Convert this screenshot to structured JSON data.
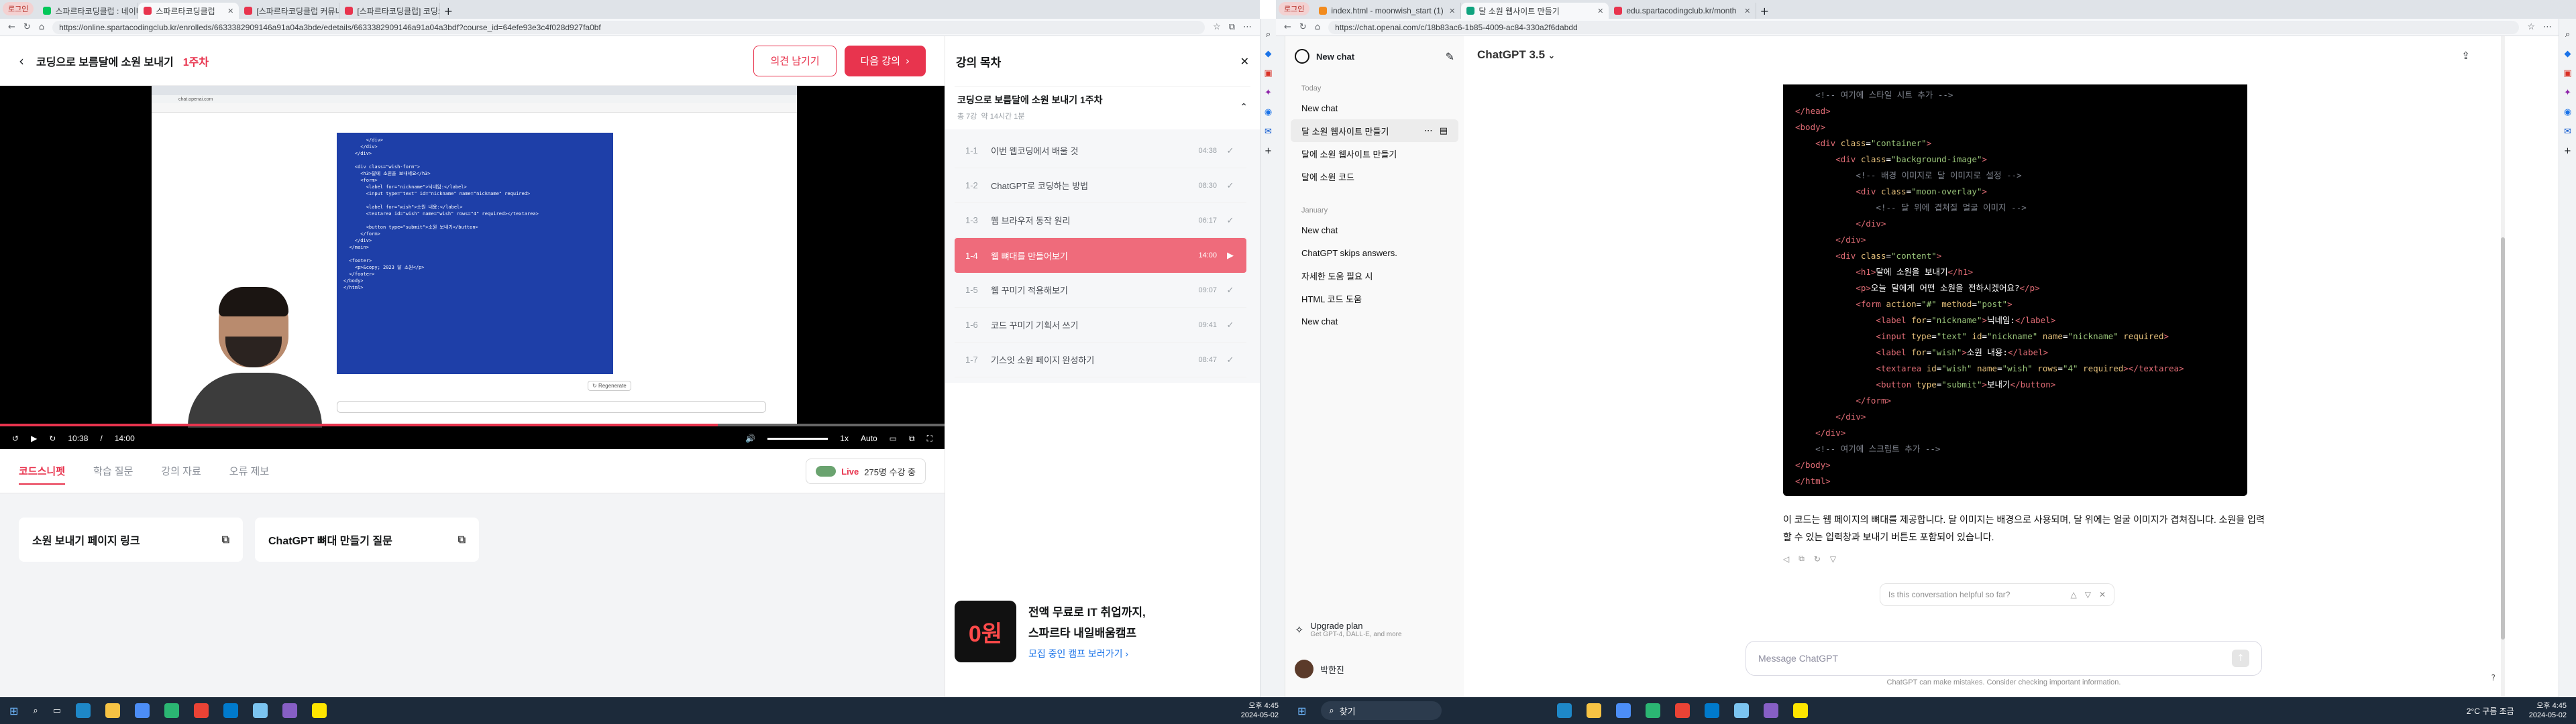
{
  "left_browser": {
    "profile": "로그인",
    "tabs": [
      {
        "label": "스파르타코딩클럽 : 네이버 통합",
        "active": false
      },
      {
        "label": "스파르타코딩클럽",
        "active": true
      },
      {
        "label": "[스파르타코딩클럽 커뮤니티] 스피",
        "active": false
      },
      {
        "label": "[스파르타코딩클럽] 코딩으로 보",
        "active": false
      }
    ],
    "url": "https://online.spartacodingclub.kr/enrolleds/6633382909146a91a04a3bde/edetails/6633382909146a91a04a3bdf?course_id=64efe93e3c4f028d927fa0bf"
  },
  "course": {
    "title": "코딩으로 보름달에 소원 보내기",
    "week": "1주차",
    "ask_button": "의견 남기기",
    "next_button": "다음 강의",
    "video": {
      "current": "10:38",
      "total": "14:00",
      "speed": "1x",
      "quality": "Auto",
      "progress": 0.76
    },
    "inner_url": "chat.openai.com",
    "inner_title": "ChatGPT",
    "regenerate": "Regenerate",
    "tabs": [
      "코드스니펫",
      "학습 질문",
      "강의 자료",
      "오류 제보"
    ],
    "live_label": "Live",
    "live_count": "275명 수강 중",
    "cards": [
      "소원 보내기 페이지 링크",
      "ChatGPT 뼈대 만들기 질문"
    ]
  },
  "toc": {
    "title": "강의 목차",
    "section_title": "코딩으로 보름달에 소원 보내기 1주차",
    "section_meta1": "총 7강",
    "section_meta2": "약 14시간 1분",
    "items": [
      {
        "num": "1-1",
        "label": "이번 웹코딩에서 배울 것",
        "time": "04:38",
        "done": true
      },
      {
        "num": "1-2",
        "label": "ChatGPT로 코딩하는 방법",
        "time": "08:30",
        "done": true
      },
      {
        "num": "1-3",
        "label": "웹 브라우저 동작 원리",
        "time": "06:17",
        "done": true
      },
      {
        "num": "1-4",
        "label": "웹 뼈대를 만들어보기",
        "time": "14:00",
        "done": false,
        "current": true
      },
      {
        "num": "1-5",
        "label": "웹 꾸미기 적용해보기",
        "time": "09:07",
        "done": true
      },
      {
        "num": "1-6",
        "label": "코드 꾸미기 기획서 쓰기",
        "time": "09:41",
        "done": true
      },
      {
        "num": "1-7",
        "label": "기스잇 소원 페이지 완성하기",
        "time": "08:47",
        "done": true
      }
    ],
    "promo_badge": "0원",
    "promo_line1": "전액 무료로 IT 취업까지,",
    "promo_line2": "스파르타 내일배움캠프",
    "promo_link": "모집 중인 캠프 보러가기"
  },
  "right_browser": {
    "profile": "로그인",
    "tabs": [
      {
        "label": "index.html - moonwish_start (1)",
        "active": false
      },
      {
        "label": "달 소원 웹사이트 만들기",
        "active": true
      },
      {
        "label": "edu.spartacodingclub.kr/month",
        "active": false
      }
    ],
    "url": "https://chat.openai.com/c/18b83ac6-1b85-4009-ac84-330a2f6dabdd"
  },
  "gpt": {
    "new_chat": "New chat",
    "model": "ChatGPT 3.5",
    "sections": [
      {
        "label": "Today",
        "items": [
          "New chat",
          "달 소원 웹사이트 만들기",
          "달에 소원 웹사이트 만들기",
          "달에 소원 코드"
        ]
      },
      {
        "label": "January",
        "items": [
          "New chat",
          "ChatGPT skips answers.",
          "자세한 도움 필요 시",
          "HTML 코드 도움",
          "New chat"
        ]
      }
    ],
    "upgrade_title": "Upgrade plan",
    "upgrade_sub": "Get GPT-4, DALL·E, and more",
    "user": "박한진",
    "reply": "이 코드는 웹 페이지의 뼈대를 제공합니다. 달 이미지는 배경으로 사용되며, 달 위에는 얼굴 이미지가 겹쳐집니다. 소원을 입력할 수 있는 입력창과 보내기 버튼도 포함되어 있습니다.",
    "feedback": "Is this conversation helpful so far?",
    "placeholder": "Message ChatGPT",
    "disclaimer": "ChatGPT can make mistakes. Consider checking important information."
  },
  "taskbar_left": {
    "time": "오후 4:45",
    "date": "2024-05-02"
  },
  "taskbar_right": {
    "search": "찾기",
    "weather": "2°C 구름 조금",
    "time": "오후 4:45",
    "date": "2024-05-02"
  }
}
